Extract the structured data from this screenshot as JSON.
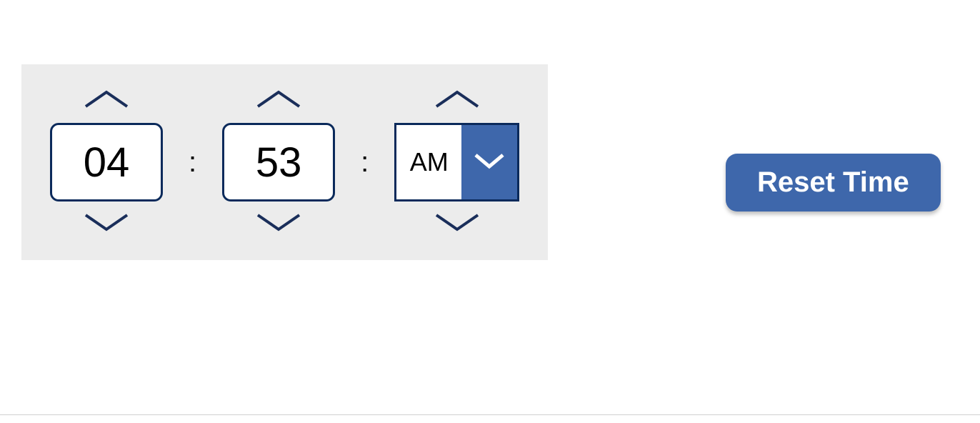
{
  "time": {
    "hours": "04",
    "minutes": "53",
    "ampm": "AM",
    "separator": ":"
  },
  "reset_label": "Reset Time"
}
